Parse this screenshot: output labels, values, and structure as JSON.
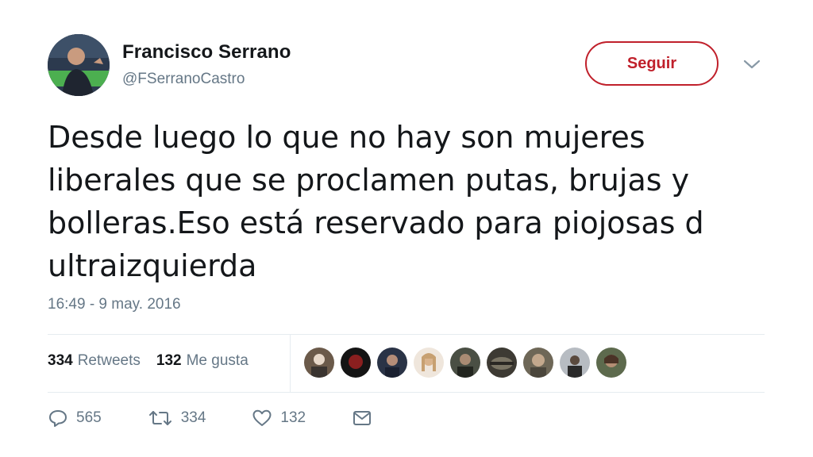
{
  "tweet": {
    "author_name": "Francisco Serrano",
    "author_handle": "@FSerranoCastro",
    "follow_label": "Seguir",
    "text": "Desde luego lo que no hay son mujeres\nliberales que se proclamen putas, brujas y\nbolleras.Eso está reservado para piojosas d\nultraizquierda",
    "timestamp": "16:49 - 9 may. 2016"
  },
  "stats": {
    "retweets_count": "334",
    "retweets_label": "Retweets",
    "likes_count": "132",
    "likes_label": "Me gusta"
  },
  "actions": {
    "reply_count": "565",
    "retweet_count": "334",
    "like_count": "132"
  },
  "icons": {
    "caret": "chevron-down-icon",
    "reply": "reply-icon",
    "retweet": "retweet-icon",
    "like": "heart-icon",
    "message": "envelope-icon"
  },
  "colors": {
    "follow_accent": "#c0202b",
    "muted_text": "#657786",
    "primary_text": "#14171a"
  }
}
